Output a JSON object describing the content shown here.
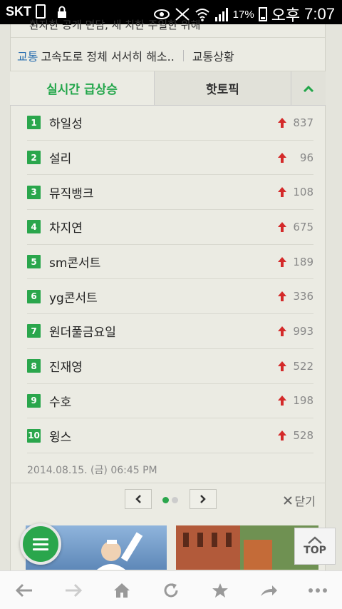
{
  "status_bar": {
    "carrier": "SKT",
    "battery": "17%",
    "ampm": "오후",
    "time": "7:07"
  },
  "headline_partial": "환자한 공개 면담, 새 치한 주일한 위해",
  "traffic": {
    "category": "교통",
    "headline": "고속도로 정체 서서히 해소..",
    "link": "교통상황"
  },
  "tabs": {
    "realtime": "실시간 급상승",
    "hottopic": "핫토픽"
  },
  "trending": [
    {
      "rank": "1",
      "term": "하일성",
      "count": "837"
    },
    {
      "rank": "2",
      "term": "설리",
      "count": "96"
    },
    {
      "rank": "3",
      "term": "뮤직뱅크",
      "count": "108"
    },
    {
      "rank": "4",
      "term": "차지연",
      "count": "675"
    },
    {
      "rank": "5",
      "term": "sm콘서트",
      "count": "189"
    },
    {
      "rank": "6",
      "term": "yg콘서트",
      "count": "336"
    },
    {
      "rank": "7",
      "term": "원더풀금요일",
      "count": "993"
    },
    {
      "rank": "8",
      "term": "진재영",
      "count": "522"
    },
    {
      "rank": "9",
      "term": "수호",
      "count": "198"
    },
    {
      "rank": "10",
      "term": "윙스",
      "count": "528"
    }
  ],
  "datetime": "2014.08.15. (금) 06:45 PM",
  "pager": {
    "close_label": "닫기",
    "pages": 2,
    "current": 1
  },
  "top_button": "TOP",
  "colors": {
    "accent": "#2aa64c",
    "arrow_up": "#d42a2a",
    "link": "#2a6fb0"
  },
  "icons": [
    "back-icon",
    "forward-icon",
    "home-icon",
    "reload-icon",
    "bookmark-star-icon",
    "share-icon",
    "more-icon"
  ]
}
